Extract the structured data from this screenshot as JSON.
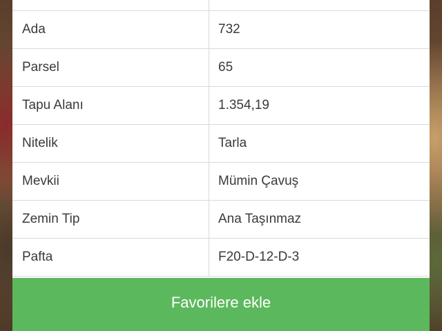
{
  "details": {
    "rows": [
      {
        "label": "Ada",
        "value": "732"
      },
      {
        "label": "Parsel",
        "value": "65"
      },
      {
        "label": "Tapu Alanı",
        "value": "1.354,19"
      },
      {
        "label": "Nitelik",
        "value": "Tarla"
      },
      {
        "label": "Mevkii",
        "value": "Mümin Çavuş"
      },
      {
        "label": "Zemin Tip",
        "value": "Ana Taşınmaz"
      },
      {
        "label": "Pafta",
        "value": "F20-D-12-D-3"
      }
    ]
  },
  "actions": {
    "favorite_label": "Favorilere ekle"
  },
  "colors": {
    "button_green": "#5cb85c",
    "border": "#d9d9d9",
    "text": "#3a3a3a"
  }
}
